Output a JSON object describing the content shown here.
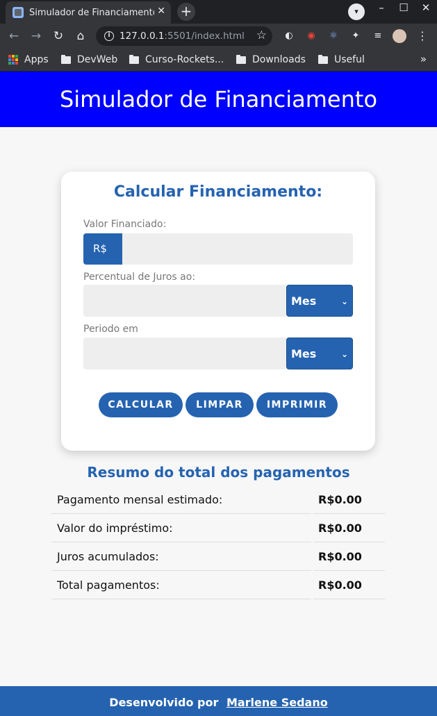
{
  "browser": {
    "tab_title": "Simulador de Financiamento",
    "tab_close": "✕",
    "new_tab": "+",
    "tab_search": "▾",
    "window_controls": {
      "minimize": "–",
      "maximize": "☐",
      "close": "✕"
    },
    "nav": {
      "back": "←",
      "forward": "→",
      "reload": "↻",
      "home": "⌂"
    },
    "url_host": "127.0.0.1",
    "url_rest": ":5501/index.html",
    "bookmark_star": "☆",
    "menu": "⋮",
    "extensions": [
      {
        "name": "grammar-icon",
        "glyph": "◐",
        "color": "#e8eaed"
      },
      {
        "name": "color-wheel-icon",
        "glyph": "◉",
        "color": "#e94235"
      },
      {
        "name": "react-devtools-icon",
        "glyph": "⚛",
        "color": "#8ab4f8"
      },
      {
        "name": "puzzle-icon",
        "glyph": "✦",
        "color": "#e8eaed"
      },
      {
        "name": "media-control-icon",
        "glyph": "≡",
        "color": "#e8eaed"
      }
    ],
    "bookmarks": [
      {
        "label": "Apps",
        "icon": "apps-grid-icon"
      },
      {
        "label": "DevWeb",
        "icon": "folder-icon"
      },
      {
        "label": "Curso-Rockets...",
        "icon": "folder-icon"
      },
      {
        "label": "Downloads",
        "icon": "folder-icon"
      },
      {
        "label": "Useful",
        "icon": "folder-icon"
      }
    ],
    "bookmarks_more": "»"
  },
  "header": {
    "title": "Simulador de Financiamento"
  },
  "form": {
    "title": "Calcular Financiamento:",
    "valor_label": "Valor Financiado:",
    "currency_prefix": "R$",
    "valor_value": "",
    "juros_label": "Percentual de Juros ao:",
    "juros_value": "",
    "juros_period": "Mes",
    "periodo_label": "Periodo em",
    "periodo_value": "",
    "periodo_unit": "Mes",
    "caret": "⌄",
    "buttons": {
      "calcular": "CALCULAR",
      "limpar": "LIMPAR",
      "imprimir": "IMPRIMIR"
    }
  },
  "summary": {
    "title": "Resumo do total dos pagamentos",
    "rows": [
      {
        "label": "Pagamento mensal estimado:",
        "value": "R$0.00"
      },
      {
        "label": "Valor do impréstimo:",
        "value": "R$0.00"
      },
      {
        "label": "Juros acumulados:",
        "value": "R$0.00"
      },
      {
        "label": "Total pagamentos:",
        "value": "R$0.00"
      }
    ]
  },
  "footer": {
    "prefix": "Desenvolvido por",
    "author": "Marlene Sedano"
  },
  "colors": {
    "header_bg": "#0000ff",
    "accent": "#2563b0",
    "page_bg": "#f7f7f7"
  }
}
